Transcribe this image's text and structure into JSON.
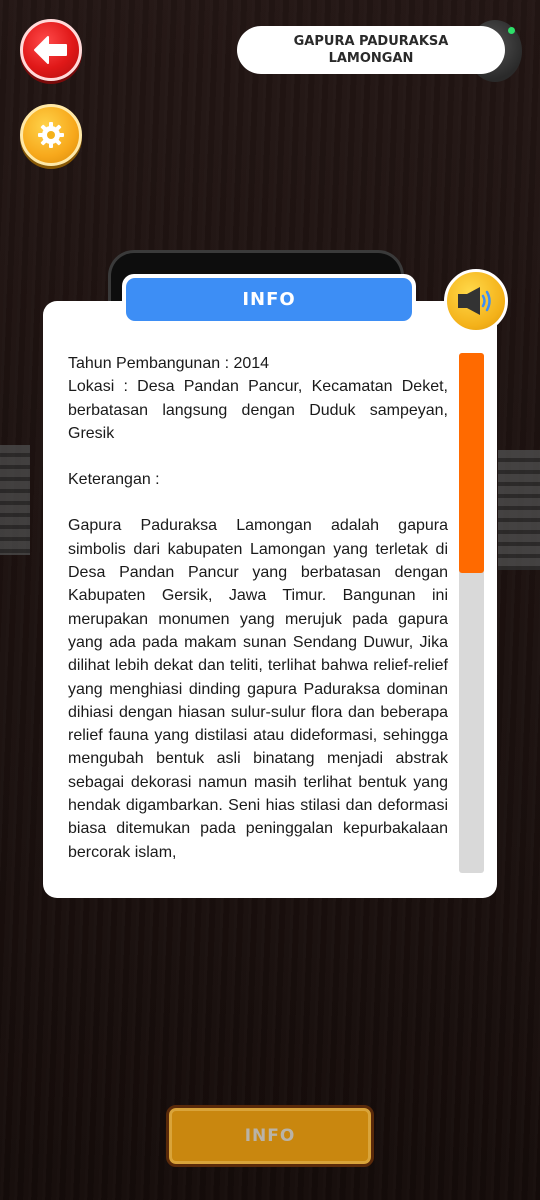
{
  "header": {
    "title_line1": "GAPURA PADURAKSA",
    "title_line2": "LAMONGAN"
  },
  "icons": {
    "back": "arrow-left-icon",
    "settings": "gear-icon",
    "sound": "speaker-icon"
  },
  "panel": {
    "tab_label": "INFO",
    "year_line": "Tahun Pembangunan : 2014",
    "location_line": "Lokasi : Desa Pandan Pancur, Kecamatan Deket, berbatasan langsung dengan Duduk sampeyan, Gresik",
    "notes_heading": "Keterangan :",
    "description": "Gapura Paduraksa Lamongan adalah gapura simbolis dari kabupaten Lamongan  yang terletak di Desa Pandan Pancur yang berbatasan dengan Kabupaten Gersik, Jawa Timur. Bangunan ini merupakan monumen yang merujuk pada gapura yang ada pada makam sunan Sendang Duwur, Jika dilihat lebih dekat dan teliti, terlihat bahwa relief-relief yang menghiasi dinding gapura Paduraksa dominan dihiasi dengan hiasan sulur-sulur flora dan beberapa relief fauna yang distilasi atau dideformasi, sehingga mengubah bentuk asli binatang menjadi abstrak sebagai dekorasi namun masih terlihat bentuk yang hendak digambarkan. Seni hias stilasi dan deformasi biasa ditemukan pada peninggalan kepurbakalaan bercorak islam,"
  },
  "footer": {
    "info_button_label": "INFO"
  },
  "colors": {
    "tab_blue": "#3d8ef5",
    "scroll_thumb": "#ff6a00",
    "back_red": "#e01818",
    "gear_yellow": "#f7a81b"
  }
}
